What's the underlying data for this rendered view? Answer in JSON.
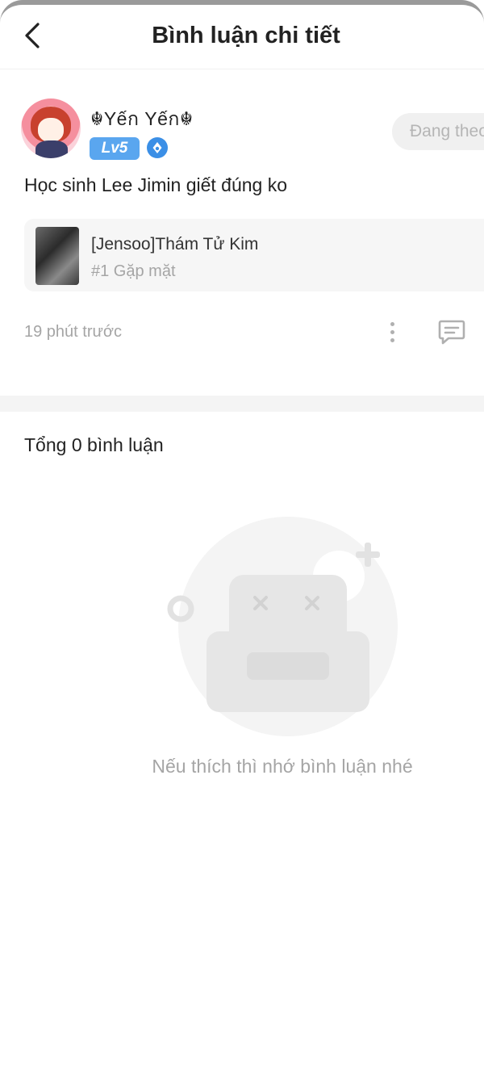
{
  "header": {
    "title": "Bình luận chi tiết",
    "back_icon": "chevron-left-icon"
  },
  "post": {
    "username": "☬Yếก Yếก☬",
    "level": "Lv5",
    "follow_label": "Đang theo dõi",
    "content": "Học sinh Lee Jimin giết đúng ko",
    "book": {
      "title": "[Jensoo]Thám Tử Kim",
      "chapter": "#1 Gặp mặt"
    },
    "time": "19 phút trước"
  },
  "comments": {
    "total_label": "Tổng 0 bình luận",
    "empty_text": "Nếu thích thì nhớ bình luận nhé"
  },
  "colors": {
    "accent": "#5aa6ef",
    "muted_text": "#a5a5a5",
    "illustration": "#eeeeee"
  }
}
